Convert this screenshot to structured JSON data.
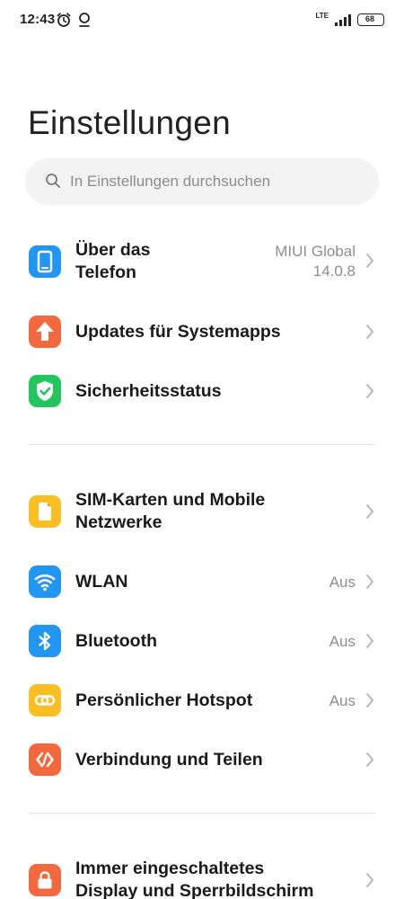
{
  "status_bar": {
    "time": "12:43",
    "network": "LTE",
    "battery": "68",
    "icons": [
      "alarm-icon",
      "face-icon",
      "signal-icon",
      "battery-icon"
    ]
  },
  "title": "Einstellungen",
  "search": {
    "placeholder": "In Einstellungen durchsuchen"
  },
  "items": {
    "about_phone": {
      "label_line1": "Über das",
      "label_line2": "Telefon",
      "value_line1": "MIUI Global",
      "value_line2": "14.0.8",
      "icon": "phone-icon",
      "color": "#2196f3"
    },
    "updates": {
      "label": "Updates für Systemapps",
      "icon": "arrow-up-icon",
      "color": "#f4683d"
    },
    "security": {
      "label": "Sicherheitsstatus",
      "icon": "shield-check-icon",
      "color": "#22c55e"
    },
    "sim": {
      "label_line1": "SIM-Karten und Mobile",
      "label_line2": "Netzwerke",
      "icon": "sim-card-icon",
      "color": "#fbbf24"
    },
    "wlan": {
      "label": "WLAN",
      "value": "Aus",
      "icon": "wifi-icon",
      "color": "#2196f3"
    },
    "bluetooth": {
      "label": "Bluetooth",
      "value": "Aus",
      "icon": "bluetooth-icon",
      "color": "#2196f3"
    },
    "hotspot": {
      "label": "Persönlicher Hotspot",
      "value": "Aus",
      "icon": "hotspot-icon",
      "color": "#fbbf24"
    },
    "connection": {
      "label": "Verbindung und Teilen",
      "icon": "share-icon",
      "color": "#f4683d"
    },
    "aod": {
      "label_line1": "Immer eingeschaltetes",
      "label_line2": "Display und Sperrbildschirm",
      "icon": "lock-icon",
      "color": "#f4683d"
    }
  }
}
